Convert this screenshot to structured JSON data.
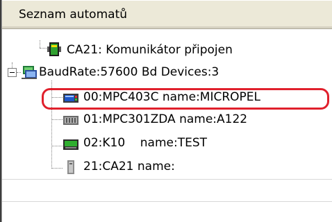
{
  "panel": {
    "title": "Seznam automatů"
  },
  "tree": {
    "communicator": {
      "label": "CA21: Komunikátor připojen",
      "icon": "plc-green-icon"
    },
    "bus": {
      "label": "BaudRate:57600 Bd Devices:3",
      "icon": "network-bus-icon",
      "expanded": true,
      "children": [
        {
          "label": "00:MPC403C name:MICROPEL",
          "icon": "blue-plc-icon",
          "highlighted": true
        },
        {
          "label": "01:MPC301ZDA name:A122",
          "icon": "gray-plc-icon"
        },
        {
          "label": "02:K10    name:TEST",
          "icon": "green-terminal-icon"
        },
        {
          "label": "21:CA21 name:",
          "icon": "gray-module-icon"
        }
      ]
    }
  },
  "colors": {
    "highlight": "#e0202c",
    "header_bg": "#ece9d8"
  }
}
